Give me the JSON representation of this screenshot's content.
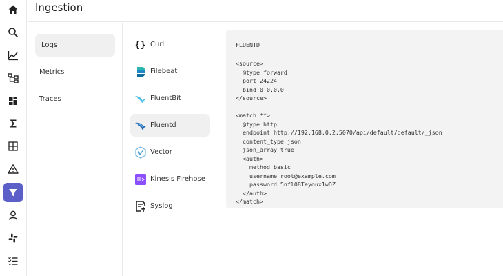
{
  "header": {
    "title": "Ingestion"
  },
  "nav": {
    "icons": [
      "home-icon",
      "search-icon",
      "metrics-icon",
      "traces-icon",
      "dashboards-icon",
      "functions-icon",
      "streams-icon",
      "alerts-icon",
      "ingestion-icon",
      "iam-icon",
      "slack-icon",
      "reports-icon"
    ],
    "active": "ingestion-icon",
    "accent": "#5b5fc7"
  },
  "categories": [
    {
      "label": "Logs",
      "active": true
    },
    {
      "label": "Metrics",
      "active": false
    },
    {
      "label": "Traces",
      "active": false
    }
  ],
  "sources": [
    {
      "label": "Curl",
      "icon": "curl-icon",
      "active": false
    },
    {
      "label": "Filebeat",
      "icon": "filebeat-icon",
      "active": false
    },
    {
      "label": "FluentBit",
      "icon": "fluentbit-icon",
      "active": false
    },
    {
      "label": "Fluentd",
      "icon": "fluentd-icon",
      "active": true
    },
    {
      "label": "Vector",
      "icon": "vector-icon",
      "active": false
    },
    {
      "label": "Kinesis Firehose",
      "icon": "kinesis-firehose-icon",
      "active": false
    },
    {
      "label": "Syslog",
      "icon": "syslog-icon",
      "active": false
    }
  ],
  "code": {
    "title": "FLUENTD",
    "lines": [
      "<source>",
      "  @type forward",
      "  port 24224",
      "  bind 0.0.0.0",
      "</source>",
      "",
      "<match **>",
      "  @type http",
      "  endpoint http://192.168.0.2:5070/api/default/default/_json",
      "  content_type json",
      "  json_array true",
      "  <auth>",
      "    method basic",
      "    username root@example.com",
      "    password 5nfl08Teyoux1wDZ",
      "  </auth>",
      "</match>"
    ]
  }
}
